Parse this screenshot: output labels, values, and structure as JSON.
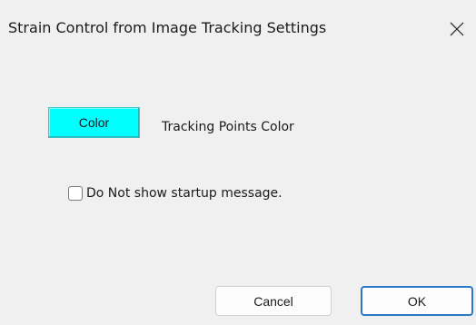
{
  "dialog": {
    "title": "Strain Control from Image Tracking Settings",
    "close_icon": "close-icon"
  },
  "tracking_color": {
    "button_label": "Color",
    "button_color": "#00ffff",
    "label": "Tracking Points Color"
  },
  "startup_message": {
    "label": "Do Not show startup message.",
    "checked": false
  },
  "buttons": {
    "cancel_label": "Cancel",
    "ok_label": "OK",
    "ok_accent": "#2b78c6"
  }
}
